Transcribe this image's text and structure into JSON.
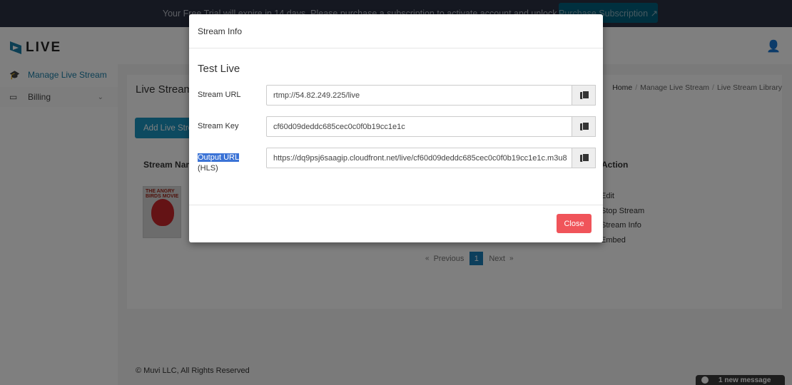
{
  "topbar": {
    "message": "Your Free Trial will expire in 14 days. Please purchase a subscription to activate account and unlock all awesome features",
    "purchase_label": "Purchase Subscription ↗"
  },
  "sidebar": {
    "logo_text": "LIVE",
    "items": [
      {
        "label": "Manage Live Stream",
        "icon": "graduation-cap-icon",
        "active": true
      },
      {
        "label": "Billing",
        "icon": "billing-card-icon",
        "expandable": true
      }
    ]
  },
  "header": {
    "user_icon": "user-settings-icon"
  },
  "page": {
    "title": "Live Stream Library",
    "breadcrumb": [
      "Home",
      "Manage Live Stream",
      "Live Stream Library"
    ],
    "add_button": "Add Live Stream",
    "table_headers": {
      "name": "Stream Name",
      "action": "Action"
    },
    "rows": [
      {
        "poster_title": "THE ANGRY BIRDS MOVIE",
        "actions": [
          "Edit",
          "Stop Stream",
          "Stream Info",
          "Embed"
        ]
      }
    ],
    "pagination": {
      "previous": "Previous",
      "current": "1",
      "next": "Next",
      "prev_arrow": "«",
      "next_arrow": "»"
    }
  },
  "footer": {
    "copyright": "© Muvi LLC, All Rights Reserved"
  },
  "chat": {
    "label": "1 new message"
  },
  "modal": {
    "header": "Stream Info",
    "title": "Test Live",
    "fields": [
      {
        "label": "Stream URL",
        "sublabel": "",
        "value": "rtmp://54.82.249.225/live"
      },
      {
        "label": "Stream Key",
        "sublabel": "",
        "value": "cf60d09deddc685cec0c0f0b19cc1e1c"
      },
      {
        "label": "Output URL",
        "sublabel": "(HLS)",
        "value": "https://dq9psj6saagip.cloudfront.net/live/cf60d09deddc685cec0c0f0b19cc1e1c.m3u8"
      }
    ],
    "close_label": "Close",
    "colors": {
      "close": "#f0545a",
      "selection": "#3b73d6"
    }
  },
  "colors": {
    "topbar": "#2a3142",
    "accent": "#1a95c1",
    "purchase": "#00607e"
  }
}
